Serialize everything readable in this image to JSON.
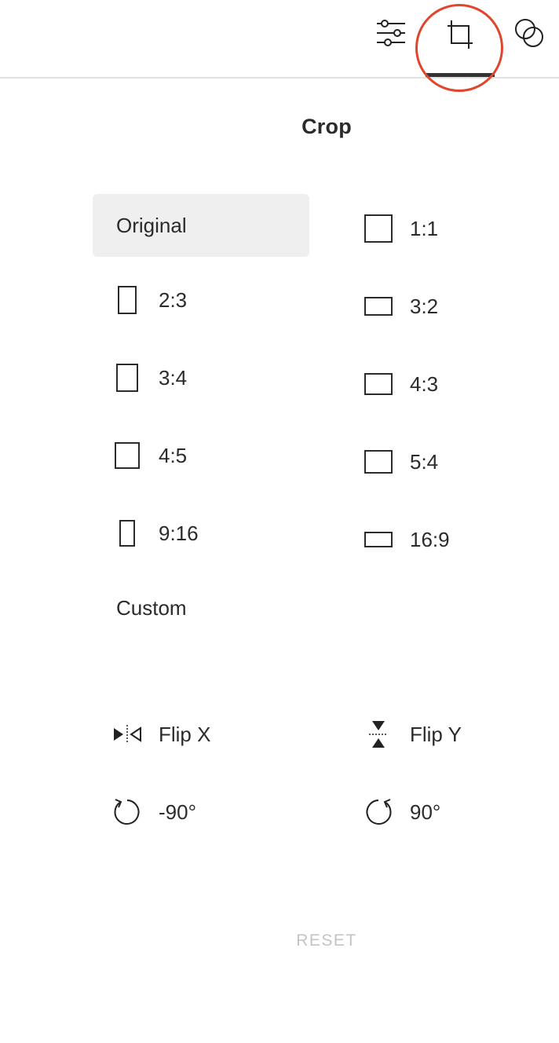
{
  "toolbar": {
    "tools": [
      {
        "name": "adjust",
        "icon": "sliders-icon"
      },
      {
        "name": "crop",
        "icon": "crop-icon",
        "active": true
      },
      {
        "name": "filters",
        "icon": "overlapping-circles-icon"
      }
    ],
    "highlight_color": "#e0452d"
  },
  "panel": {
    "title": "Crop"
  },
  "ratios": {
    "original_label": "Original",
    "custom_label": "Custom",
    "left_column": [
      "2:3",
      "3:4",
      "4:5",
      "9:16"
    ],
    "right_column": [
      "1:1",
      "3:2",
      "4:3",
      "5:4",
      "16:9"
    ]
  },
  "actions": {
    "flip_x": "Flip X",
    "flip_y": "Flip Y",
    "rotate_left": "-90°",
    "rotate_right": "90°"
  },
  "reset_label": "RESET"
}
